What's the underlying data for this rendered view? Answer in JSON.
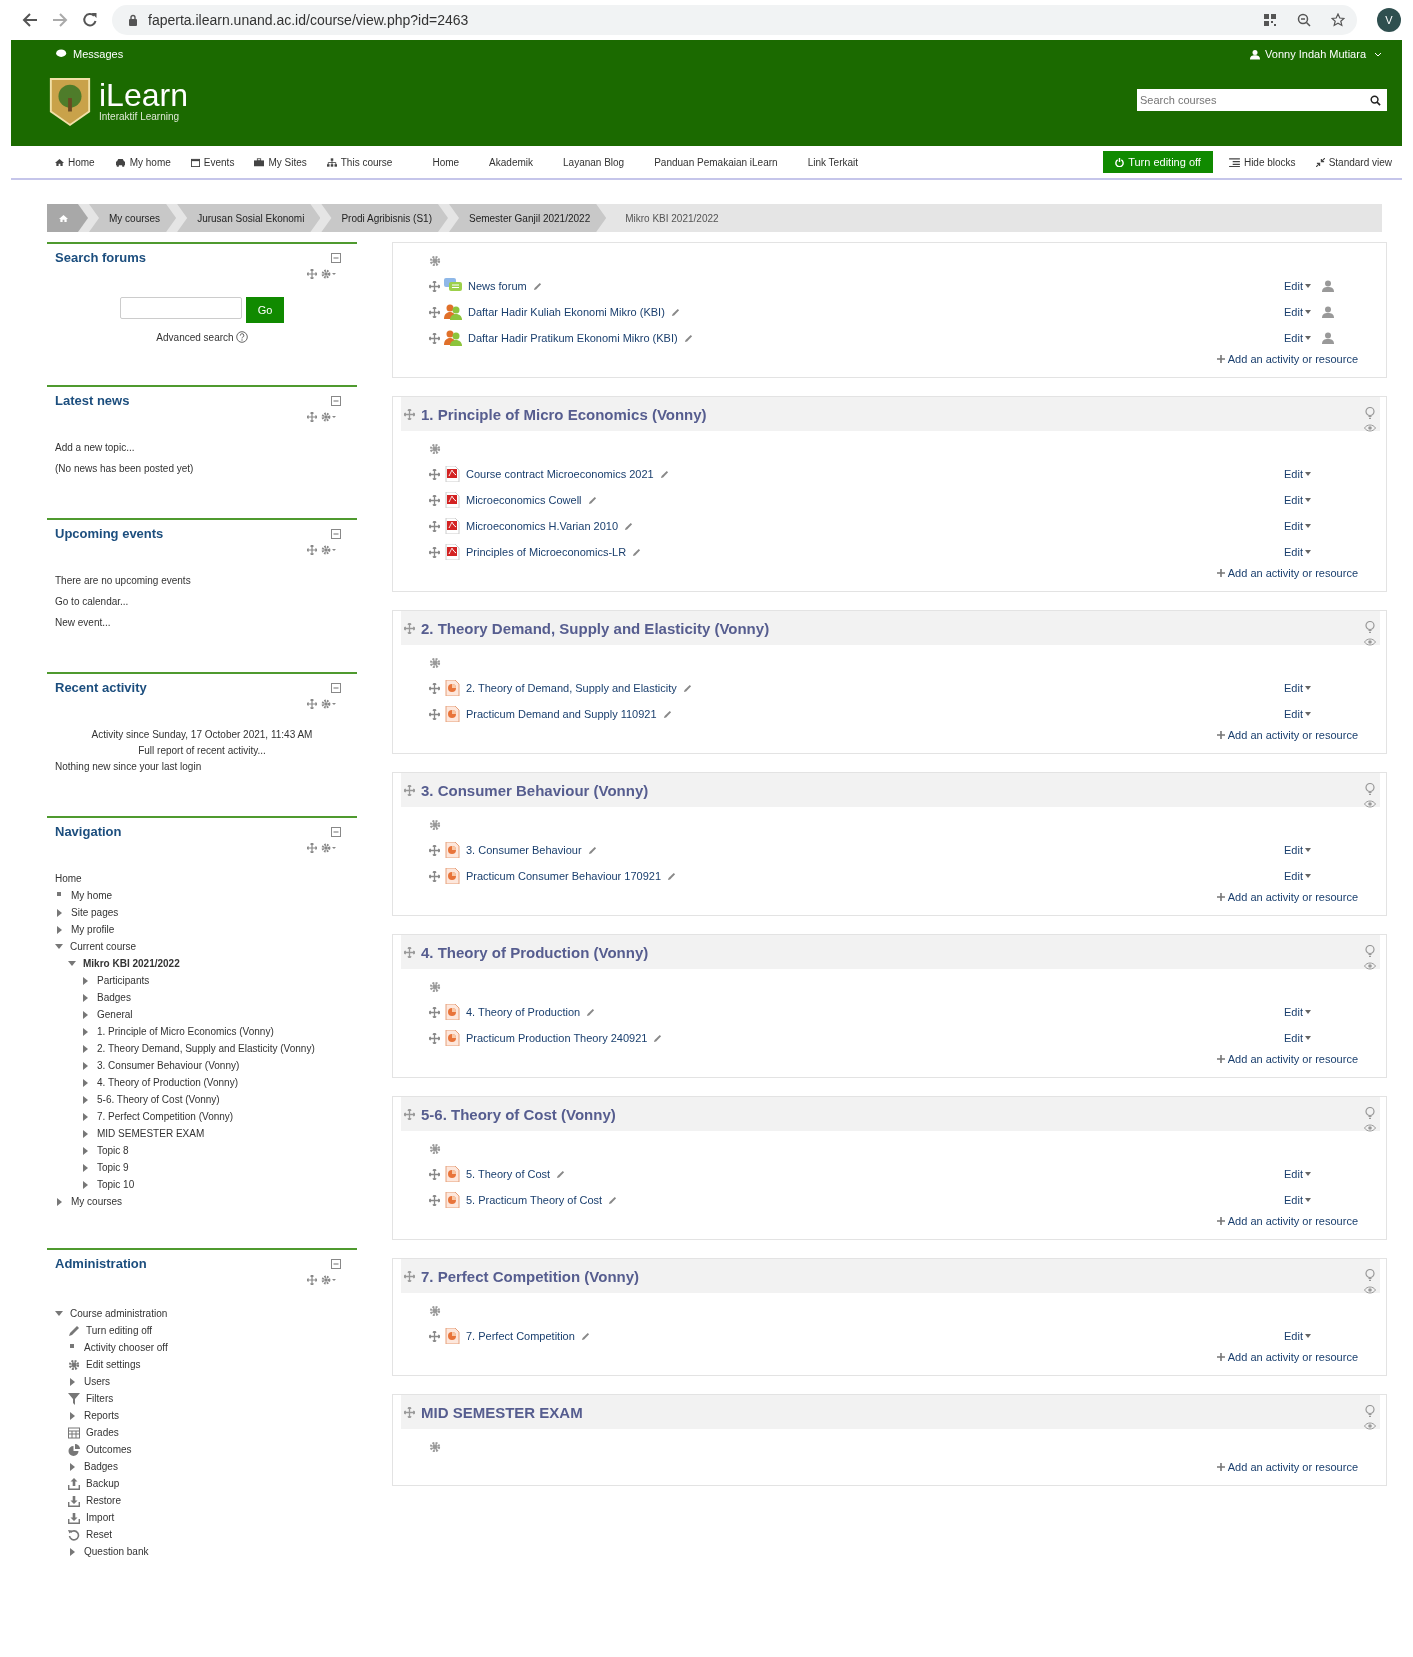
{
  "browser": {
    "url": "faperta.ilearn.unand.ac.id/course/view.php?id=2463",
    "profile_initial": "V"
  },
  "header": {
    "messages": "Messages",
    "user": "Vonny Indah Mutiara",
    "logo_title": "iLearn",
    "logo_subtitle": "Interaktif Learning",
    "search_placeholder": "Search courses"
  },
  "navbar": {
    "items": [
      {
        "label": "Home",
        "kind": "home"
      },
      {
        "label": "My home",
        "kind": "car"
      },
      {
        "label": "Events",
        "kind": "calendar"
      },
      {
        "label": "My Sites",
        "kind": "briefcase"
      },
      {
        "label": "This course",
        "kind": "sitemap"
      },
      {
        "label": "Home",
        "kind": "plain"
      },
      {
        "label": "Akademik",
        "kind": "plain"
      },
      {
        "label": "Layanan Blog",
        "kind": "plain"
      },
      {
        "label": "Panduan Pemakaian iLearn",
        "kind": "plain"
      },
      {
        "label": "Link Terkait",
        "kind": "plain"
      }
    ],
    "edit_button": "Turn editing off",
    "hide_blocks": "Hide blocks",
    "standard_view": "Standard view"
  },
  "breadcrumb": {
    "items": [
      "My courses",
      "Jurusan Sosial Ekonomi",
      "Prodi Agribisnis (S1)",
      "Semester Ganjil 2021/2022"
    ],
    "current": "Mikro KBI 2021/2022"
  },
  "blocks": [
    {
      "kind": "search",
      "title": "Search forums",
      "button": "Go",
      "advanced": "Advanced search"
    },
    {
      "kind": "lines",
      "title": "Latest news",
      "lines": [
        {
          "text": "Add a new topic..."
        },
        {
          "text": "(No news has been posted yet)"
        }
      ]
    },
    {
      "kind": "lines",
      "title": "Upcoming events",
      "lines": [
        {
          "text": "There are no upcoming events"
        },
        {
          "text": "Go to calendar..."
        },
        {
          "text": "New event..."
        }
      ]
    },
    {
      "kind": "lines",
      "title": "Recent activity",
      "lines": [
        {
          "text": "Activity since Sunday, 17 October 2021, 11:43 AM"
        },
        {
          "text": "Full report of recent activity..."
        },
        {
          "text": "Nothing new since your last login"
        }
      ]
    },
    {
      "kind": "navigation",
      "title": "Navigation",
      "root": "Home",
      "items": [
        {
          "label": "My home",
          "kind": "leaf"
        },
        {
          "label": "Site pages",
          "kind": "branch",
          "expanded": false
        },
        {
          "label": "My profile",
          "kind": "branch",
          "expanded": false
        },
        {
          "label": "Current course",
          "kind": "branch",
          "expanded": true,
          "children": [
            {
              "label": "Mikro KBI 2021/2022",
              "kind": "branch",
              "expanded": true,
              "current": true,
              "children": [
                {
                  "label": "Participants",
                  "kind": "branch",
                  "expanded": false
                },
                {
                  "label": "Badges",
                  "kind": "branch",
                  "expanded": false
                },
                {
                  "label": "General",
                  "kind": "branch",
                  "expanded": false
                },
                {
                  "label": "1. Principle of Micro Economics (Vonny)",
                  "kind": "branch",
                  "expanded": false
                },
                {
                  "label": "2. Theory Demand, Supply and Elasticity (Vonny)",
                  "kind": "branch",
                  "expanded": false
                },
                {
                  "label": "3. Consumer Behaviour (Vonny)",
                  "kind": "branch",
                  "expanded": false
                },
                {
                  "label": "4. Theory of Production (Vonny)",
                  "kind": "branch",
                  "expanded": false
                },
                {
                  "label": "5-6. Theory of Cost (Vonny)",
                  "kind": "branch",
                  "expanded": false
                },
                {
                  "label": "7. Perfect Competition (Vonny)",
                  "kind": "branch",
                  "expanded": false
                },
                {
                  "label": "MID SEMESTER EXAM",
                  "kind": "branch",
                  "expanded": false
                },
                {
                  "label": "Topic 8",
                  "kind": "branch",
                  "expanded": false
                },
                {
                  "label": "Topic 9",
                  "kind": "branch",
                  "expanded": false
                },
                {
                  "label": "Topic 10",
                  "kind": "branch",
                  "expanded": false
                }
              ]
            }
          ]
        },
        {
          "label": "My courses",
          "kind": "branch",
          "expanded": false
        }
      ]
    },
    {
      "kind": "admin",
      "title": "Administration",
      "items": [
        {
          "label": "Course administration",
          "kind": "branch",
          "expanded": true,
          "children": [
            {
              "label": "Turn editing off",
              "kind": "pencil"
            },
            {
              "label": "Activity chooser off",
              "kind": "leaf"
            },
            {
              "label": "Edit settings",
              "kind": "gear"
            },
            {
              "label": "Users",
              "kind": "branch",
              "expanded": false
            },
            {
              "label": "Filters",
              "kind": "filter"
            },
            {
              "label": "Reports",
              "kind": "branch",
              "expanded": false
            },
            {
              "label": "Grades",
              "kind": "table"
            },
            {
              "label": "Outcomes",
              "kind": "pie"
            },
            {
              "label": "Badges",
              "kind": "branch",
              "expanded": false
            },
            {
              "label": "Backup",
              "kind": "upload"
            },
            {
              "label": "Restore",
              "kind": "download"
            },
            {
              "label": "Import",
              "kind": "download"
            },
            {
              "label": "Reset",
              "kind": "reset"
            },
            {
              "label": "Question bank",
              "kind": "branch",
              "expanded": false
            }
          ]
        }
      ]
    }
  ],
  "sections": [
    {
      "activities": [
        {
          "name": "News forum",
          "kind": "forum",
          "edit": "Edit",
          "groups": true
        },
        {
          "name": "Daftar Hadir Kuliah Ekonomi Mikro (KBI)",
          "kind": "attendance",
          "edit": "Edit",
          "groups": true
        },
        {
          "name": "Daftar Hadir Pratikum Ekonomi Mikro (KBI)",
          "kind": "attendance",
          "edit": "Edit",
          "groups": true
        }
      ],
      "add": "Add an activity or resource"
    },
    {
      "title": "1. Principle of Micro Economics (Vonny)",
      "activities": [
        {
          "name": "Course contract Microeconomics 2021",
          "kind": "pdf",
          "edit": "Edit",
          "groups": false
        },
        {
          "name": "Microeconomics Cowell",
          "kind": "pdf",
          "edit": "Edit",
          "groups": false
        },
        {
          "name": "Microeconomics H.Varian 2010",
          "kind": "pdf",
          "edit": "Edit",
          "groups": false
        },
        {
          "name": "Principles of Microeconomics-LR",
          "kind": "pdf",
          "edit": "Edit",
          "groups": false
        }
      ],
      "add": "Add an activity or resource"
    },
    {
      "title": "2. Theory Demand, Supply and Elasticity (Vonny)",
      "activities": [
        {
          "name": "2. Theory of Demand, Supply and Elasticity",
          "kind": "slides",
          "edit": "Edit",
          "groups": false
        },
        {
          "name": "Practicum Demand and Supply 110921",
          "kind": "slides",
          "edit": "Edit",
          "groups": false
        }
      ],
      "add": "Add an activity or resource"
    },
    {
      "title": "3. Consumer Behaviour (Vonny)",
      "activities": [
        {
          "name": "3. Consumer Behaviour",
          "kind": "slides",
          "edit": "Edit",
          "groups": false
        },
        {
          "name": "Practicum Consumer Behaviour 170921",
          "kind": "slides",
          "edit": "Edit",
          "groups": false
        }
      ],
      "add": "Add an activity or resource"
    },
    {
      "title": "4. Theory of Production (Vonny)",
      "activities": [
        {
          "name": "4. Theory of Production",
          "kind": "slides",
          "edit": "Edit",
          "groups": false
        },
        {
          "name": "Practicum Production Theory 240921",
          "kind": "slides",
          "edit": "Edit",
          "groups": false
        }
      ],
      "add": "Add an activity or resource"
    },
    {
      "title": "5-6. Theory of Cost (Vonny)",
      "activities": [
        {
          "name": "5. Theory of Cost",
          "kind": "slides",
          "edit": "Edit",
          "groups": false
        },
        {
          "name": "5. Practicum Theory of Cost",
          "kind": "slides",
          "edit": "Edit",
          "groups": false
        }
      ],
      "add": "Add an activity or resource"
    },
    {
      "title": "7. Perfect Competition (Vonny)",
      "activities": [
        {
          "name": "7. Perfect Competition",
          "kind": "slides",
          "edit": "Edit",
          "groups": false
        }
      ],
      "add": "Add an activity or resource"
    },
    {
      "title": "MID SEMESTER EXAM",
      "add": "Add an activity or resource"
    }
  ]
}
